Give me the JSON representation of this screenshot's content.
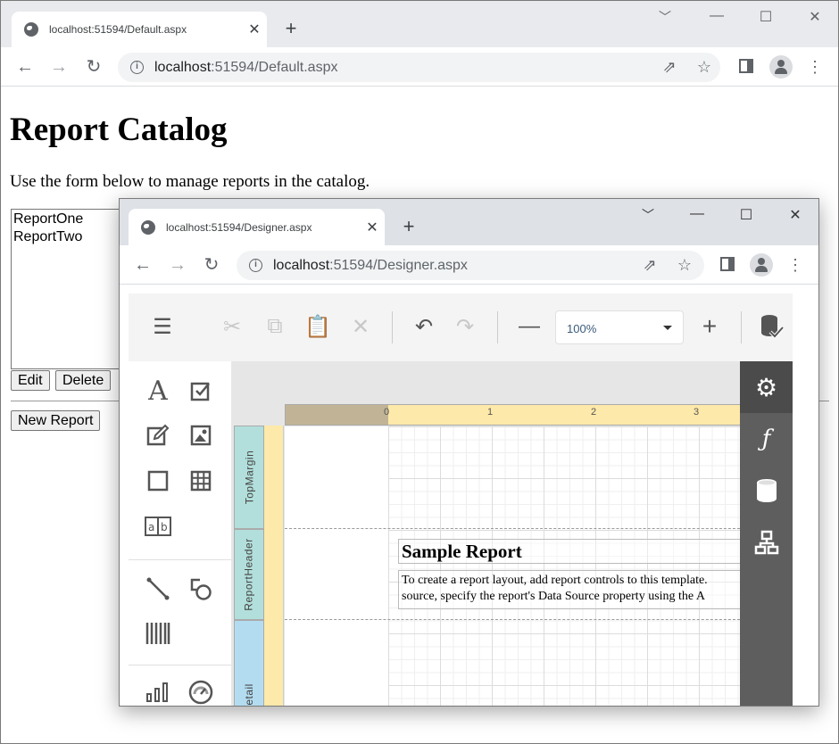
{
  "outer_browser": {
    "tab_title": "localhost:51594/Default.aspx",
    "url_host": "localhost",
    "url_rest": ":51594/Default.aspx",
    "new_tab": "+",
    "tab_close": "✕"
  },
  "page": {
    "heading": "Report Catalog",
    "description": "Use the form below to manage reports in the catalog.",
    "reports": [
      "ReportOne",
      "ReportTwo"
    ],
    "edit_label": "Edit",
    "delete_label": "Delete",
    "new_report_label": "New Report"
  },
  "inner_browser": {
    "tab_title": "localhost:51594/Designer.aspx",
    "url_host": "localhost",
    "url_rest": ":51594/Designer.aspx",
    "new_tab": "+",
    "tab_close": "✕"
  },
  "designer": {
    "zoom_value": "100%",
    "ruler_numbers": [
      "0",
      "1",
      "2",
      "3"
    ],
    "bands": [
      "TopMargin",
      "ReportHeader",
      "Detail"
    ],
    "report_title": "Sample Report",
    "report_text_line1": "To create a report layout, add report controls to this template.",
    "report_text_line2": "source, specify the report's  Data Source property using the A",
    "accent_active_panel": "#4b4b4b",
    "panel_color": "#5e5e5e",
    "ruler_color": "#fde9a9",
    "band_margin_color": "#b2dfdb",
    "band_detail_color": "#b3dcf0"
  }
}
